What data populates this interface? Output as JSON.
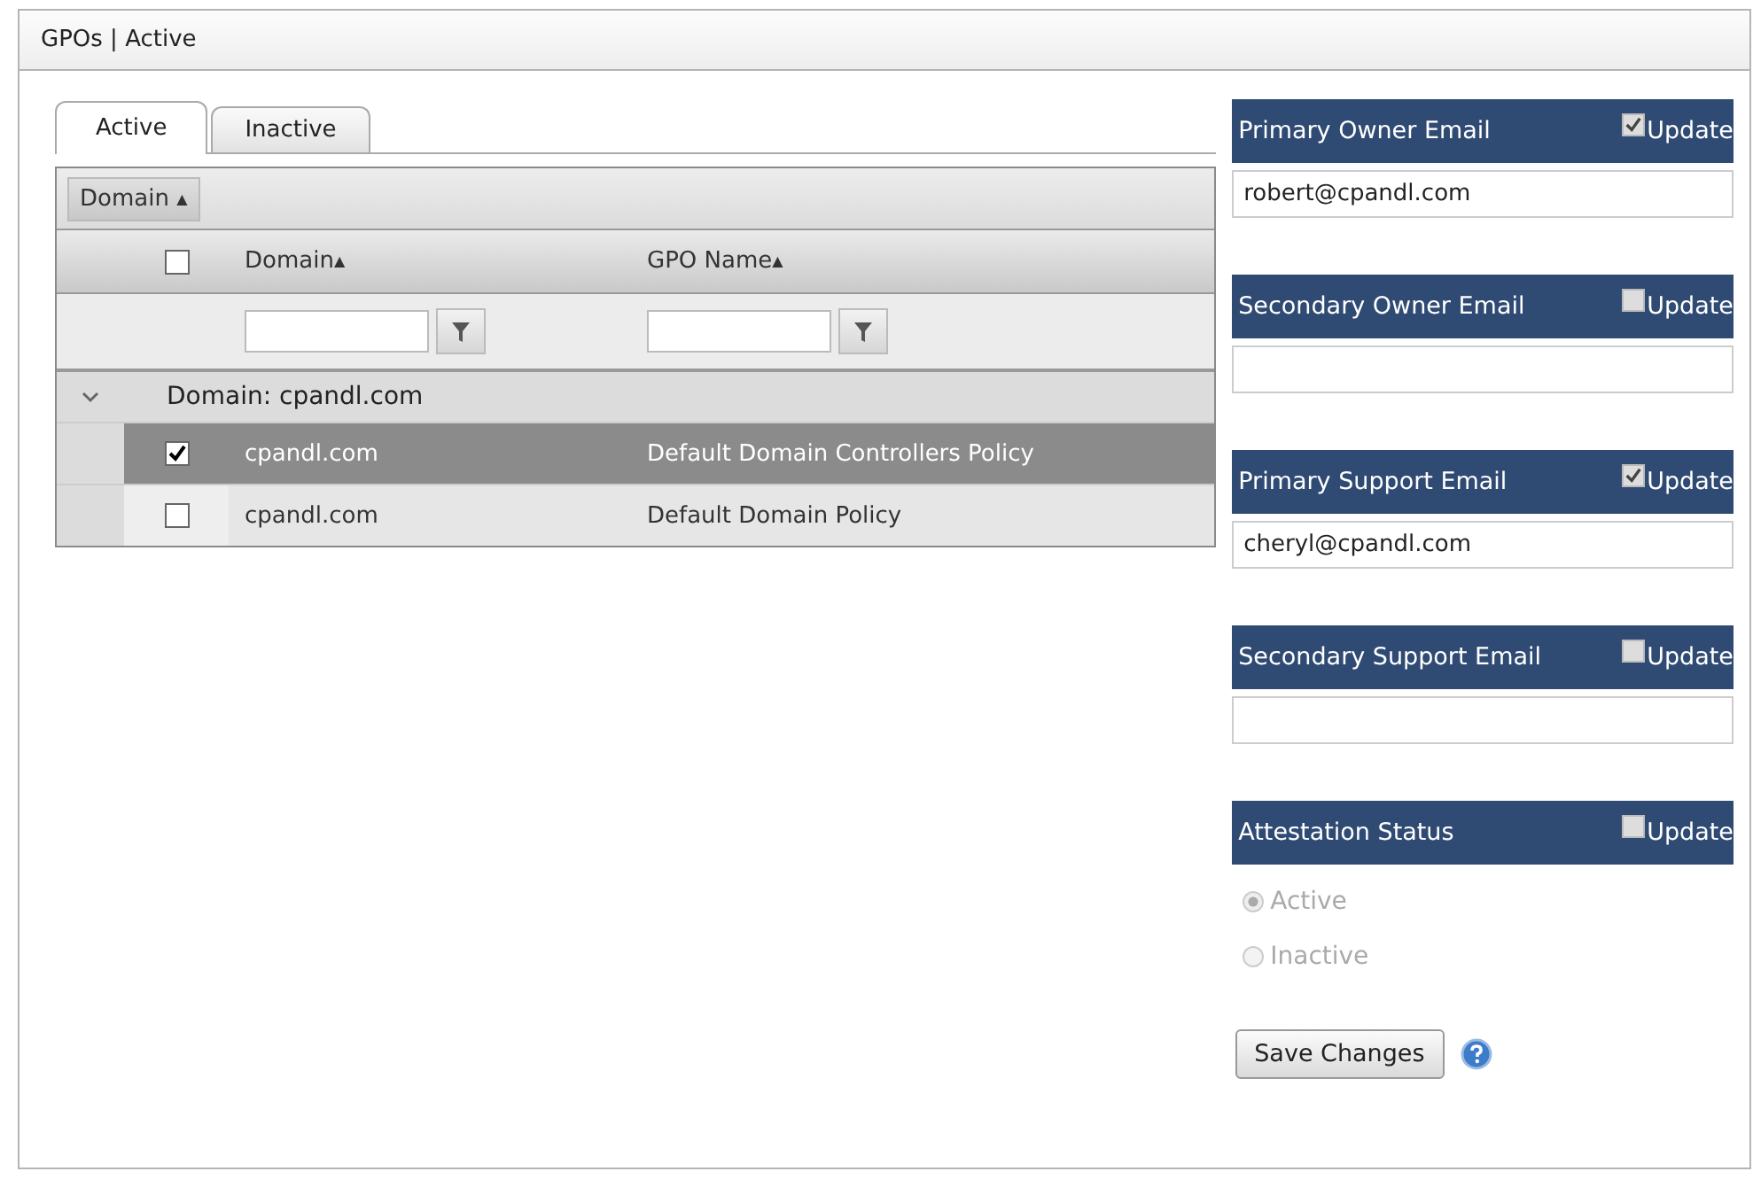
{
  "window": {
    "title": "GPOs | Active"
  },
  "tabs": [
    {
      "label": "Active",
      "selected": true
    },
    {
      "label": "Inactive",
      "selected": false
    }
  ],
  "grid": {
    "group_by": {
      "label": "Domain",
      "sort": "▲"
    },
    "select_all": {
      "checked": false
    },
    "columns": [
      {
        "label": "Domain",
        "sort": "▲"
      },
      {
        "label": "GPO Name",
        "sort": "▲"
      }
    ],
    "group": {
      "label": "Domain: cpandl.com",
      "expanded": true
    },
    "rows": [
      {
        "domain": "cpandl.com",
        "gpo_name": "Default Domain Controllers Policy",
        "checked": true,
        "selected": true
      },
      {
        "domain": "cpandl.com",
        "gpo_name": "Default Domain Policy",
        "checked": false,
        "selected": false
      }
    ]
  },
  "sections": [
    {
      "kind": "field",
      "title": "Primary Owner Email",
      "update_label": "Update",
      "update_checked": true,
      "value": "robert@cpandl.com"
    },
    {
      "kind": "field",
      "title": "Secondary Owner Email",
      "update_label": "Update",
      "update_checked": false
    },
    {
      "kind": "field",
      "title": "Primary Support Email",
      "update_label": "Update",
      "update_checked": true,
      "value": "cheryl@cpandl.com"
    },
    {
      "kind": "field",
      "title": "Secondary Support Email",
      "update_label": "Update",
      "update_checked": false
    },
    {
      "kind": "radios",
      "title": "Attestation Status",
      "update_label": "Update",
      "update_checked": false,
      "disabled": true,
      "options": [
        {
          "label": "Active",
          "selected": true
        },
        {
          "label": "Inactive",
          "selected": false
        }
      ]
    }
  ],
  "save_button": "Save Changes"
}
